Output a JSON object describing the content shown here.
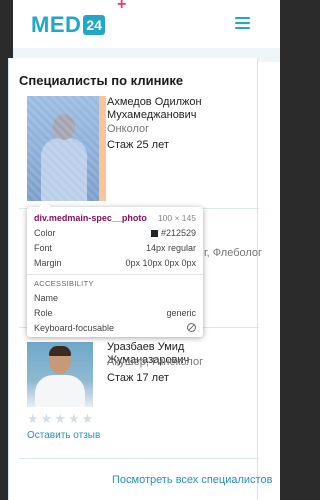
{
  "header": {
    "logo_text": "MED",
    "logo_badge": "24",
    "logo_plus": "+",
    "menu_icon": "hamburger-menu-icon"
  },
  "section": {
    "title": "Специалисты по клинике"
  },
  "doctors": [
    {
      "name": "Ахмедов Одилжон Мухамеджанович",
      "specialty": "Онколог",
      "experience": "Стаж 25 лет"
    },
    {
      "specialty_partial": "г, Флеболог"
    },
    {
      "name": "Уразбаев Умид Жуманазарович",
      "specialty": "Акушер, Гинеколог",
      "experience": "Стаж 17 лет",
      "review_link": "Оставить отзыв"
    }
  ],
  "footer": {
    "all_specialists_link": "Посмотреть всех специалистов"
  },
  "inspector": {
    "selector": "div.medmain-spec__photo",
    "size": "100 × 145",
    "color_label": "Color",
    "color_value": "#212529",
    "font_label": "Font",
    "font_value": "14px regular",
    "margin_label": "Margin",
    "margin_value": "0px 10px 0px 0px",
    "accessibility_heading": "ACCESSIBILITY",
    "name_label": "Name",
    "name_value": "",
    "role_label": "Role",
    "role_value": "generic",
    "focusable_label": "Keyboard-focusable"
  },
  "colors": {
    "brand": "#22a7c9",
    "accent": "#e8386d",
    "link": "#2a8fb8",
    "inspector_selector": "#88105d"
  }
}
